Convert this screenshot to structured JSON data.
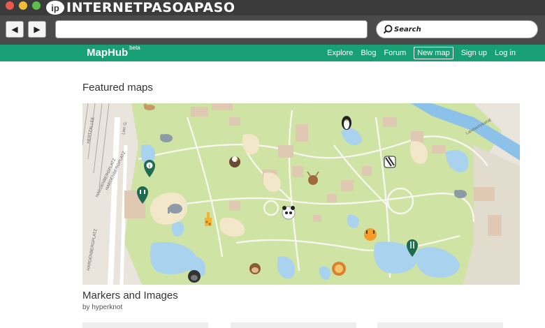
{
  "watermark": {
    "badge": "ip",
    "text": "INTERNETPASOAPASO"
  },
  "browser": {
    "back_icon": "back-arrow-icon",
    "forward_icon": "forward-arrow-icon",
    "url": "",
    "search_label": "Search"
  },
  "site": {
    "brand": "MapHub",
    "brand_badge": "beta",
    "nav": {
      "explore": "Explore",
      "blog": "Blog",
      "forum": "Forum",
      "new_map": "New map",
      "sign_up": "Sign up",
      "log_in": "Log in"
    },
    "accent": "#16a074"
  },
  "featured": {
    "heading": "Featured maps",
    "map": {
      "title": "Markers and Images",
      "byline": "by hyperknot",
      "street_labels": [
        "HERTZALLEE",
        "HARDENBERGPLATZ",
        "HARDENBERGPLATZ",
        "HARDENBERGPLATZ",
        "Landwehrkanal",
        "Lion G."
      ],
      "markers": [
        "penguin",
        "zebra",
        "eagle",
        "deer",
        "rhino",
        "info",
        "toilets",
        "elephant",
        "giraffe",
        "panda",
        "tiger",
        "restaurant",
        "gorilla",
        "monkey",
        "lion",
        "hippo",
        "camel"
      ]
    }
  },
  "colors": {
    "park": "#cfe3a4",
    "water": "#a9d2ef",
    "building": "#dfc9b2",
    "path": "#f6f6ee"
  }
}
